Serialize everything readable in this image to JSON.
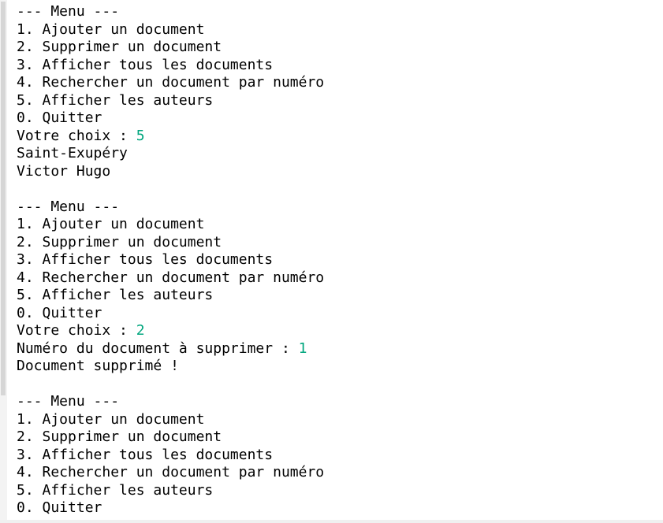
{
  "console": {
    "colors": {
      "background": "#ffffff",
      "text": "#000000",
      "user_input": "#00a67e"
    },
    "lines": [
      {
        "text": "--- Menu ---"
      },
      {
        "text": "1. Ajouter un document"
      },
      {
        "text": "2. Supprimer un document"
      },
      {
        "text": "3. Afficher tous les documents"
      },
      {
        "text": "4. Rechercher un document par numéro"
      },
      {
        "text": "5. Afficher les auteurs"
      },
      {
        "text": "0. Quitter"
      },
      {
        "text": "Votre choix : ",
        "input": "5"
      },
      {
        "text": "Saint-Exupéry"
      },
      {
        "text": "Victor Hugo"
      },
      {
        "text": ""
      },
      {
        "text": "--- Menu ---"
      },
      {
        "text": "1. Ajouter un document"
      },
      {
        "text": "2. Supprimer un document"
      },
      {
        "text": "3. Afficher tous les documents"
      },
      {
        "text": "4. Rechercher un document par numéro"
      },
      {
        "text": "5. Afficher les auteurs"
      },
      {
        "text": "0. Quitter"
      },
      {
        "text": "Votre choix : ",
        "input": "2"
      },
      {
        "text": "Numéro du document à supprimer : ",
        "input": "1"
      },
      {
        "text": "Document supprimé !"
      },
      {
        "text": ""
      },
      {
        "text": "--- Menu ---"
      },
      {
        "text": "1. Ajouter un document"
      },
      {
        "text": "2. Supprimer un document"
      },
      {
        "text": "3. Afficher tous les documents"
      },
      {
        "text": "4. Rechercher un document par numéro"
      },
      {
        "text": "5. Afficher les auteurs"
      },
      {
        "text": "0. Quitter"
      }
    ]
  }
}
